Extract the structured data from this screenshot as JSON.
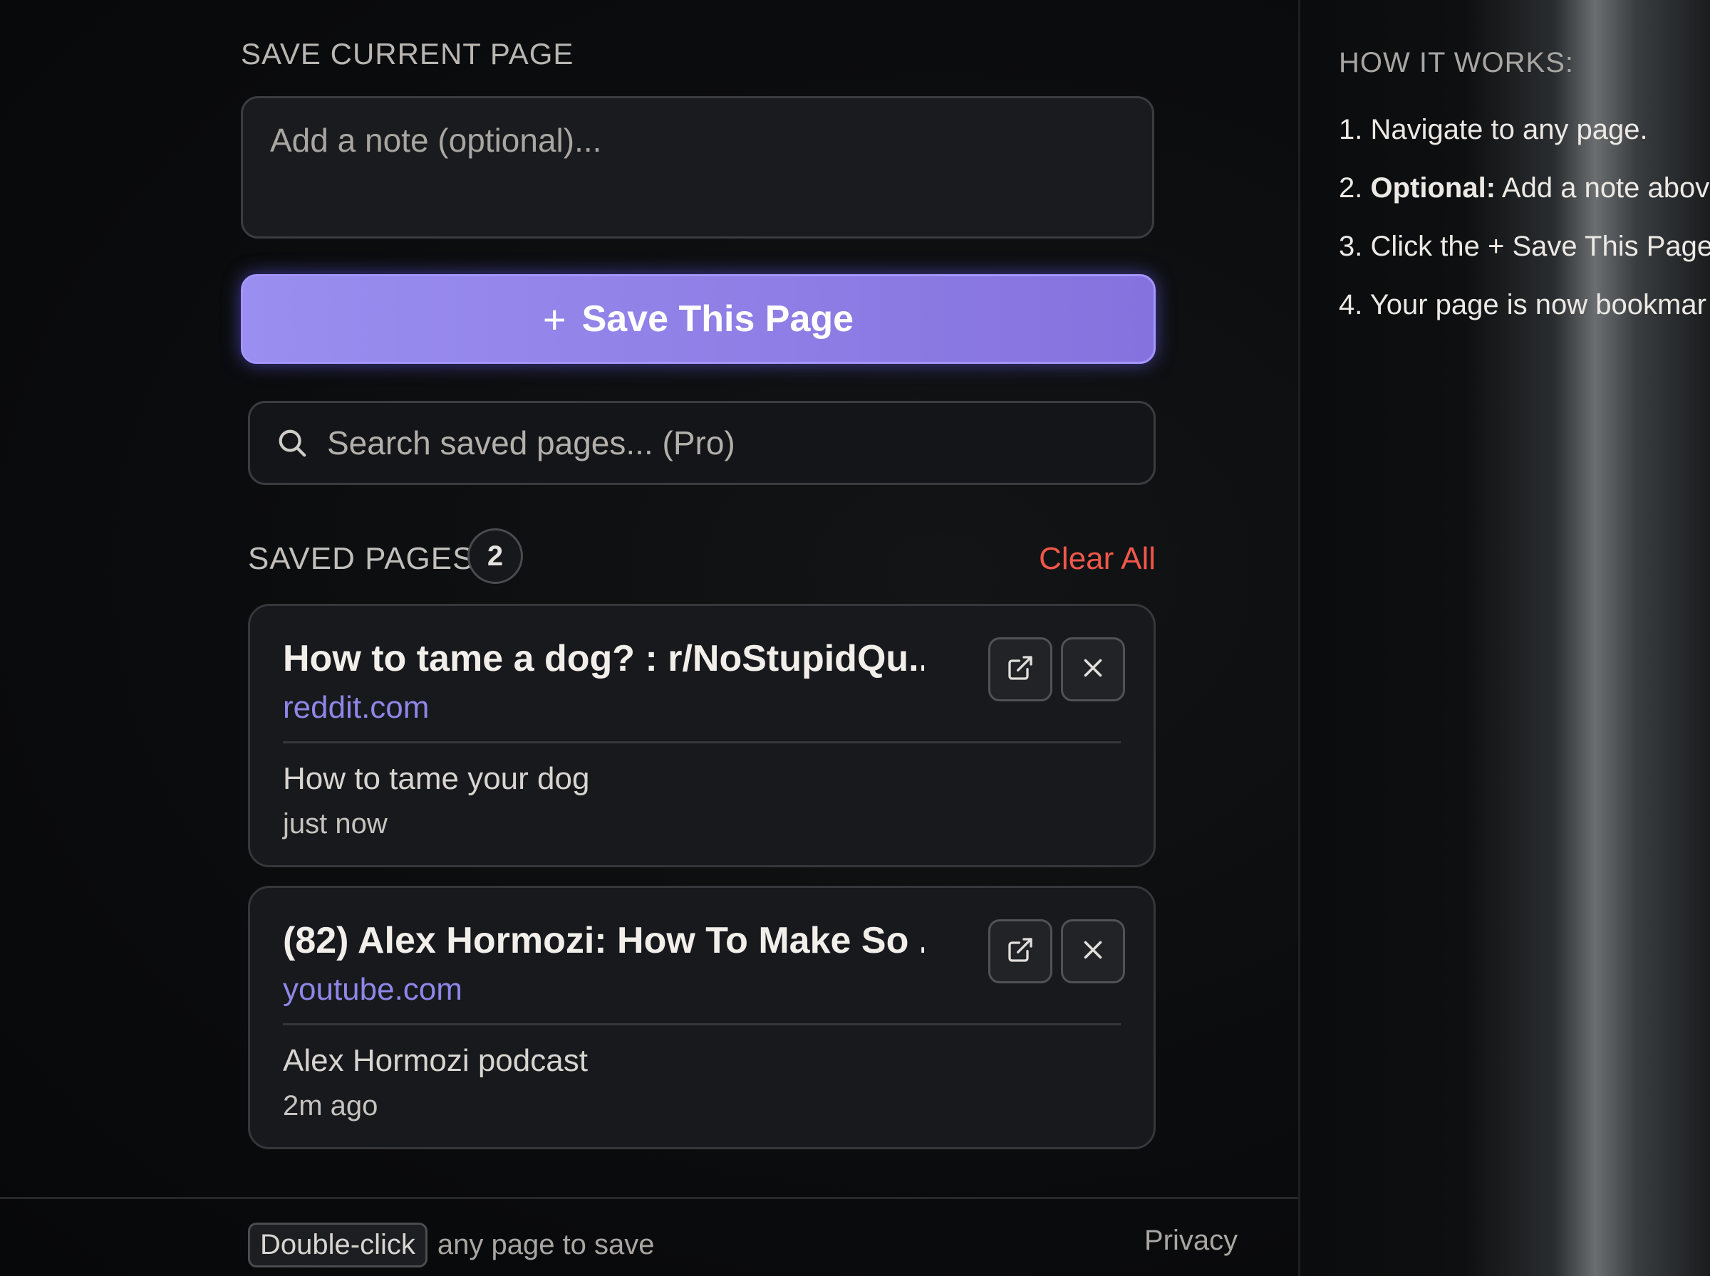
{
  "save_section": {
    "title": "SAVE CURRENT PAGE",
    "note_placeholder": "Add a note (optional)...",
    "save_button_label": "Save This Page",
    "save_button_icon": "plus-icon"
  },
  "search": {
    "placeholder": "Search saved pages... (Pro)",
    "icon": "search-icon"
  },
  "saved": {
    "title": "SAVED PAGES",
    "count": "2",
    "clear_label": "Clear All",
    "items": [
      {
        "title": "How to tame a dog? : r/NoStupidQu...",
        "domain": "reddit.com",
        "note": "How to tame your dog",
        "time": "just now"
      },
      {
        "title": "(82) Alex Hormozi: How To Make So ...",
        "domain": "youtube.com",
        "note": "Alex Hormozi podcast",
        "time": "2m ago"
      }
    ]
  },
  "footer": {
    "kbd": "Double-click",
    "hint": "any page to save",
    "privacy": "Privacy"
  },
  "how_it_works": {
    "title": "HOW IT WORKS:",
    "steps": [
      {
        "num": "1.",
        "bold": "",
        "text": "Navigate to any page."
      },
      {
        "num": "2.",
        "bold": "Optional:",
        "text": "Add a note above"
      },
      {
        "num": "3.",
        "bold": "",
        "text": "Click the + Save This Page"
      },
      {
        "num": "4.",
        "bold": "",
        "text": "Your page is now bookmar"
      }
    ]
  },
  "colors": {
    "accent": "#8f7fe6",
    "danger": "#f0574a",
    "link": "#8e86e8",
    "background": "#0b0c0e"
  }
}
